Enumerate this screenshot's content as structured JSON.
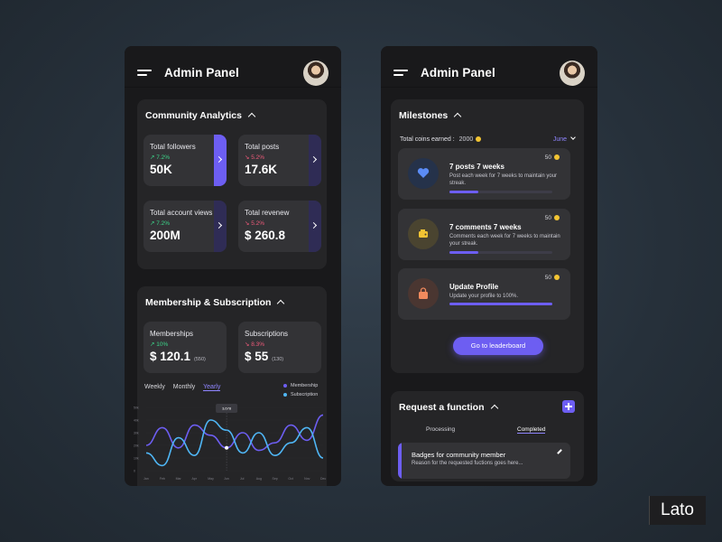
{
  "app": {
    "title": "Admin Panel"
  },
  "analytics": {
    "title": "Community Analytics",
    "cards": [
      {
        "label": "Total followers",
        "change": "7.2%",
        "trend": "up",
        "value": "50K"
      },
      {
        "label": "Total posts",
        "change": "5.2%",
        "trend": "down",
        "value": "17.6K"
      },
      {
        "label": "Total account views",
        "change": "7.2%",
        "trend": "up",
        "value": "200M"
      },
      {
        "label": "Total revenew",
        "change": "5.2%",
        "trend": "down",
        "value": "$ 260.8"
      }
    ]
  },
  "membership": {
    "title": "Membership & Subscription",
    "cards": [
      {
        "label": "Memberships",
        "change": "10%",
        "trend": "up",
        "value": "$ 120.1",
        "sub": "(550)"
      },
      {
        "label": "Subscriptions",
        "change": "8.3%",
        "trend": "down",
        "value": "$ 55",
        "sub": "(130)"
      }
    ],
    "tabs": [
      "Weekly",
      "Monthly",
      "Yearly"
    ],
    "active_tab": "Yearly",
    "legend": [
      {
        "name": "Membership",
        "color": "#6d5ef2"
      },
      {
        "name": "Subscription",
        "color": "#4fb6f5"
      }
    ]
  },
  "chart_data": {
    "type": "line",
    "tooltip": "3,678",
    "y_ticks": [
      "50k",
      "40k",
      "30k",
      "20k",
      "10k",
      "0"
    ],
    "x": [
      "Jan",
      "Feb",
      "Mar",
      "Apr",
      "May",
      "Jun",
      "Jul",
      "Aug",
      "Sep",
      "Oct",
      "Nov",
      "Dec"
    ],
    "series": [
      {
        "name": "Membership",
        "color": "#6d5ef2",
        "values": [
          20,
          34,
          18,
          36,
          28,
          18,
          30,
          16,
          22,
          36,
          24,
          44
        ]
      },
      {
        "name": "Subscription",
        "color": "#4fb6f5",
        "values": [
          14,
          4,
          26,
          12,
          40,
          32,
          14,
          30,
          12,
          22,
          34,
          10
        ]
      }
    ],
    "ylim": [
      0,
      50
    ]
  },
  "milestones": {
    "title": "Milestones",
    "coins_label": "Total coins earned :",
    "coins_value": "2000",
    "month": "June",
    "items": [
      {
        "title": "7 posts 7 weeks",
        "desc": "Post each week for 7 weeks to maintain your streak.",
        "points": "50",
        "progress": 0.28,
        "icon": "heart-icon",
        "icon_bg": "#25324a",
        "icon_color": "#5b8cf5"
      },
      {
        "title": "7 comments 7 weeks",
        "desc": "Comments each week for 7 weeks to maintain your streak.",
        "points": "50",
        "progress": 0.28,
        "icon": "wallet-icon",
        "icon_bg": "#4a4430",
        "icon_color": "#f2c433"
      },
      {
        "title": "Update Profile",
        "desc": "Update your profile to 100%.",
        "points": "50",
        "progress": 1.0,
        "icon": "bag-icon",
        "icon_bg": "#4a3631",
        "icon_color": "#f08a5d"
      }
    ],
    "button": "Go to leaderboard"
  },
  "requests": {
    "title": "Request a function",
    "tabs": [
      "Processing",
      "Completed"
    ],
    "active_tab": "Completed",
    "item": {
      "title": "Badges for community member",
      "desc": "Reason for the requested fuctions goes here..."
    }
  },
  "font_badge": "Lato"
}
